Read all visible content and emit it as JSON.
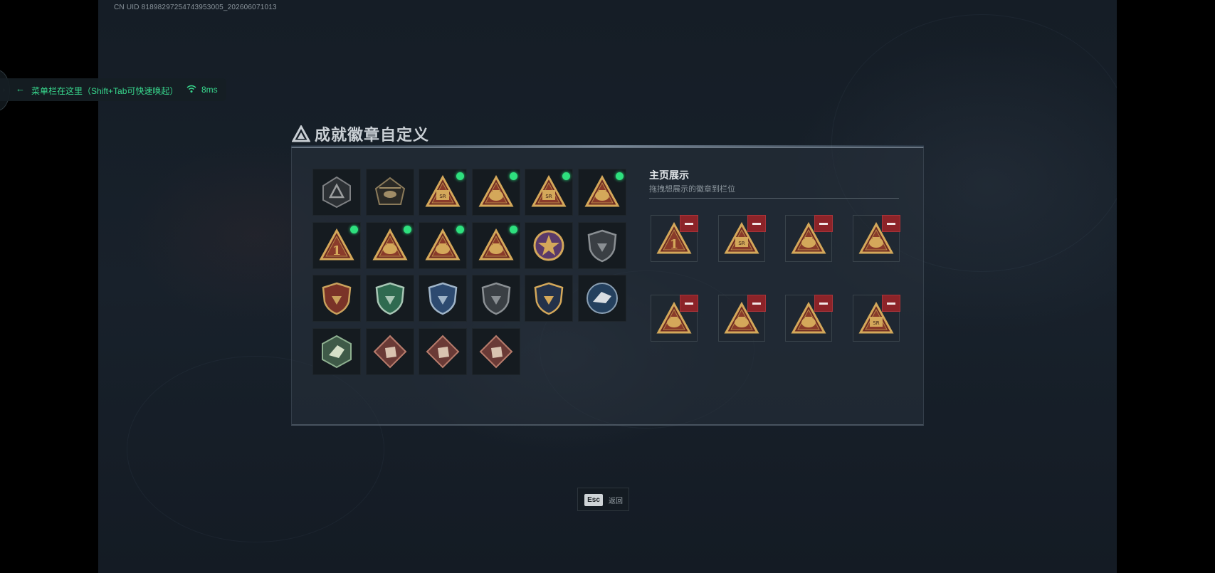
{
  "uid_text": "CN UID 81898297254743953005_202606071013",
  "menu": {
    "hint": "菜单栏在这里（Shift+Tab可快速唤起）",
    "ping": "8ms"
  },
  "dialog": {
    "title": "成就徽章自定义",
    "showcase_title": "主页展示",
    "showcase_hint": "拖拽想展示的徽章到栏位"
  },
  "badges": [
    {
      "icon": "triangle-emblem-badge-icon",
      "is_new": false
    },
    {
      "icon": "helicopter-badge-icon",
      "is_new": false
    },
    {
      "icon": "gold-triangle-sr-badge-icon",
      "is_new": true
    },
    {
      "icon": "gold-triangle-backpack-badge-icon",
      "is_new": true
    },
    {
      "icon": "gold-triangle-sr-box-badge-icon",
      "is_new": true
    },
    {
      "icon": "gold-triangle-helmet-badge-icon",
      "is_new": true
    },
    {
      "icon": "gold-triangle-number-1-badge-icon",
      "is_new": true
    },
    {
      "icon": "gold-triangle-lion-badge-icon",
      "is_new": true
    },
    {
      "icon": "gold-triangle-beast-badge-icon",
      "is_new": true
    },
    {
      "icon": "gold-triangle-rocket-badge-icon",
      "is_new": true
    },
    {
      "icon": "purple-star-medal-badge-icon",
      "is_new": false
    },
    {
      "icon": "dark-shield-badge-icon",
      "is_new": false
    },
    {
      "icon": "red-blue-shield-badge-icon",
      "is_new": false
    },
    {
      "icon": "green-shield-badge-icon",
      "is_new": false
    },
    {
      "icon": "blue-sniper-shield-badge-icon",
      "is_new": false
    },
    {
      "icon": "gun-shield-badge-icon",
      "is_new": false
    },
    {
      "icon": "gold-crossed-guns-badge-icon",
      "is_new": false
    },
    {
      "icon": "blue-wolf-badge-icon",
      "is_new": false
    },
    {
      "icon": "green-hex-bird-badge-icon",
      "is_new": false
    },
    {
      "icon": "red-diamond-beast-badge-icon",
      "is_new": false
    },
    {
      "icon": "red-diamond-beast-badge-icon",
      "is_new": false
    },
    {
      "icon": "red-diamond-runner-badge-icon",
      "is_new": false
    }
  ],
  "showcase_slots": [
    {
      "icon": "gold-triangle-number-1-badge-icon",
      "removable": true
    },
    {
      "icon": "gold-triangle-sr-badge-icon",
      "removable": true
    },
    {
      "icon": "gold-triangle-helmet-badge-icon",
      "removable": true
    },
    {
      "icon": "gold-triangle-backpack-badge-icon",
      "removable": true
    },
    {
      "icon": "gold-triangle-beast-badge-icon",
      "removable": true
    },
    {
      "icon": "gold-triangle-lion-badge-icon",
      "removable": true
    },
    {
      "icon": "gold-triangle-rocket-badge-icon",
      "removable": true
    },
    {
      "icon": "gold-triangle-sr-box-badge-icon",
      "removable": true
    }
  ],
  "footer": {
    "esc_key": "Esc",
    "back_label": "返回"
  },
  "colors": {
    "accent_green": "#2ee07e",
    "remove_red": "#8c2328",
    "badge_gold": "#d4a85a"
  }
}
